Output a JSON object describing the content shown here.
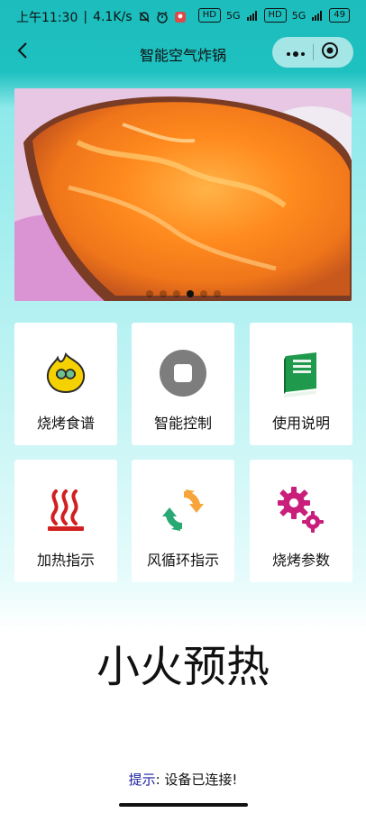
{
  "statusbar": {
    "time": "上午11:30",
    "separator": "|",
    "speed": "4.1K/s",
    "net1": "5G",
    "net2": "5G",
    "battery": "49"
  },
  "header": {
    "title": "智能空气炸锅"
  },
  "banner": {
    "dots_total": 6,
    "active_index": 3
  },
  "menu": [
    {
      "label": "烧烤食谱",
      "icon": "recipe-fire-icon"
    },
    {
      "label": "智能控制",
      "icon": "stop-button-icon"
    },
    {
      "label": "使用说明",
      "icon": "book-icon"
    },
    {
      "label": "加热指示",
      "icon": "heat-waves-icon"
    },
    {
      "label": "风循环指示",
      "icon": "recycle-arrows-icon"
    },
    {
      "label": "烧烤参数",
      "icon": "gears-icon"
    }
  ],
  "status": {
    "big_text": "小火预热"
  },
  "tip": {
    "label": "提示",
    "sep": ":",
    "message": "设备已连接!"
  },
  "colors": {
    "accent": "#1ec0c0",
    "tip_label": "#1d1fa0",
    "book": "#1f9a4c",
    "heat": "#d21f1f",
    "gear": "#c91f7b"
  }
}
